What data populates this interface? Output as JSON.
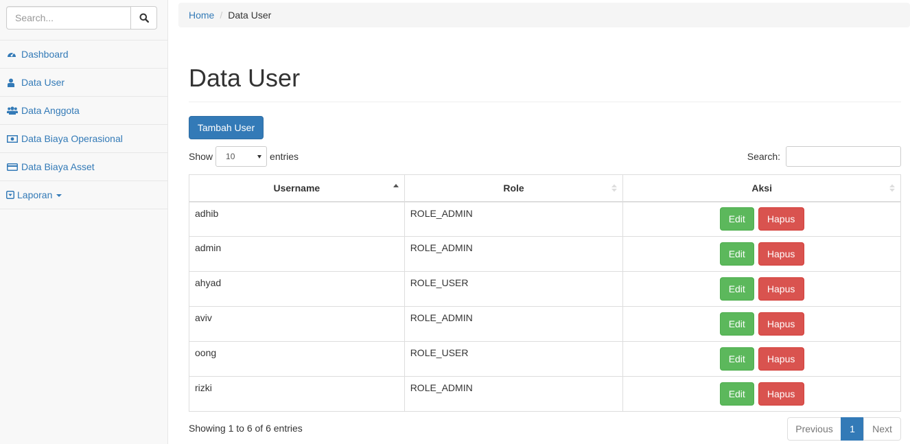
{
  "sidebar": {
    "search_placeholder": "Search...",
    "items": [
      {
        "label": "Dashboard",
        "icon": "dashboard-icon"
      },
      {
        "label": "Data User",
        "icon": "user-icon"
      },
      {
        "label": "Data Anggota",
        "icon": "users-icon"
      },
      {
        "label": "Data Biaya Operasional",
        "icon": "money-icon"
      },
      {
        "label": "Data Biaya Asset",
        "icon": "credit-card-icon"
      },
      {
        "label": "Laporan",
        "icon": "caret-square-icon"
      }
    ]
  },
  "breadcrumb": {
    "home": "Home",
    "current": "Data User"
  },
  "page": {
    "title": "Data User",
    "add_button": "Tambah User"
  },
  "datatable": {
    "show_label": "Show",
    "length_value": "10",
    "entries_label": "entries",
    "search_label": "Search:",
    "columns": [
      "Username",
      "Role",
      "Aksi"
    ],
    "rows": [
      {
        "username": "adhib",
        "role": "ROLE_ADMIN"
      },
      {
        "username": "admin",
        "role": "ROLE_ADMIN"
      },
      {
        "username": "ahyad",
        "role": "ROLE_USER"
      },
      {
        "username": "aviv",
        "role": "ROLE_ADMIN"
      },
      {
        "username": "oong",
        "role": "ROLE_USER"
      },
      {
        "username": "rizki",
        "role": "ROLE_ADMIN"
      }
    ],
    "edit_label": "Edit",
    "delete_label": "Hapus",
    "info": "Showing 1 to 6 of 6 entries",
    "pagination": {
      "previous": "Previous",
      "current_page": "1",
      "next": "Next"
    }
  },
  "colors": {
    "primary": "#337ab7",
    "success": "#5cb85c",
    "danger": "#d9534f"
  }
}
